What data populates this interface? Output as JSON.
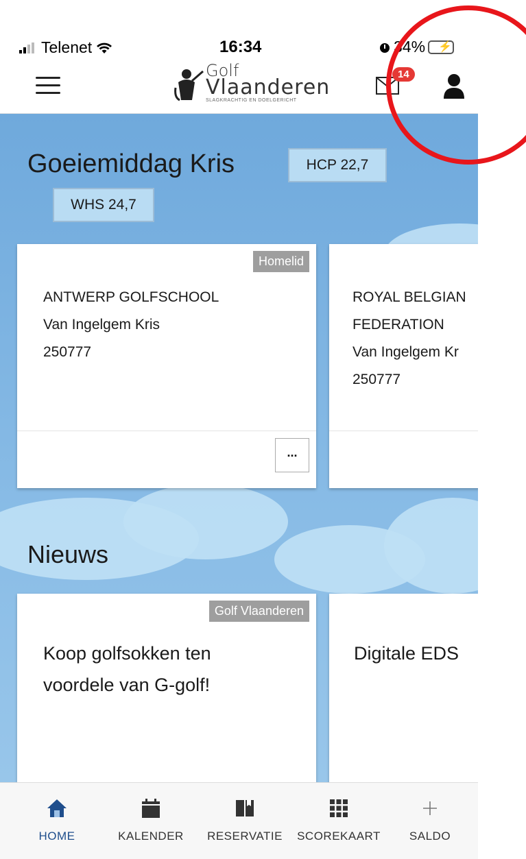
{
  "status_bar": {
    "carrier": "Telenet",
    "time": "16:34",
    "battery": "34%"
  },
  "header": {
    "logo_line1": "Golf",
    "logo_line2": "Vlaanderen",
    "logo_tagline": "SLAGKRACHTIG EN DOELGERICHT",
    "mail_badge": "14",
    "icons": [
      "menu-icon",
      "mail-icon",
      "profile-icon"
    ]
  },
  "greeting": {
    "text": "Goeiemiddag Kris",
    "hcp": "HCP 22,7",
    "whs": "WHS 24,7"
  },
  "memberships": [
    {
      "tag": "Homelid",
      "club": "ANTWERP GOLFSCHOOL",
      "name": "Van Ingelgem Kris",
      "number": "250777",
      "more_label": "..."
    },
    {
      "club_line1": "ROYAL BELGIAN",
      "club_line2": "FEDERATION",
      "name": "Van Ingelgem Kr",
      "number": "250777"
    }
  ],
  "news": {
    "title": "Nieuws",
    "items": [
      {
        "tag": "Golf Vlaanderen",
        "line1": "Koop golfsokken ten",
        "line2": "voordele van G-golf!"
      },
      {
        "line1": "Digitale EDS"
      }
    ]
  },
  "tabs": [
    {
      "label": "HOME",
      "icon": "home-icon",
      "active": true
    },
    {
      "label": "KALENDER",
      "icon": "calendar-icon",
      "active": false
    },
    {
      "label": "RESERVATIE",
      "icon": "book-icon",
      "active": false
    },
    {
      "label": "SCOREKAART",
      "icon": "grid-icon",
      "active": false
    },
    {
      "label": "SALDO",
      "icon": "plus-icon",
      "active": false
    }
  ],
  "colors": {
    "accent": "#1f4e8c",
    "hero_blue": "#6fa9dc",
    "badge_red": "#e53935",
    "annotation_red": "#e8161b"
  }
}
